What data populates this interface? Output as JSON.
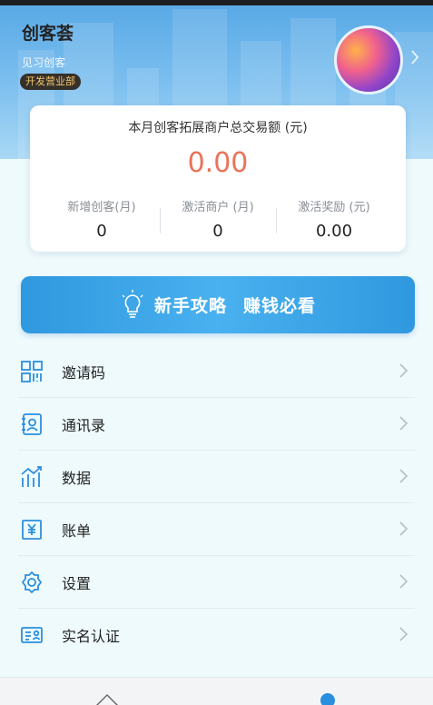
{
  "header": {
    "app_name": "创客荟",
    "role": "见习创客",
    "department": "开发营业部"
  },
  "stats": {
    "title": "本月创客拓展商户总交易额 (元)",
    "amount": "0.00",
    "items": [
      {
        "label": "新增创客(月)",
        "value": "0"
      },
      {
        "label": "激活商户 (月)",
        "value": "0"
      },
      {
        "label": "激活奖励 (元)",
        "value": "0.00"
      }
    ]
  },
  "banner": {
    "text1": "新手攻略",
    "text2": "赚钱必看"
  },
  "menu": [
    {
      "label": "邀请码",
      "icon": "qr-code-icon"
    },
    {
      "label": "通讯录",
      "icon": "contacts-icon"
    },
    {
      "label": "数据",
      "icon": "chart-icon"
    },
    {
      "label": "账单",
      "icon": "bill-icon"
    },
    {
      "label": "设置",
      "icon": "gear-icon"
    },
    {
      "label": "实名认证",
      "icon": "id-card-icon"
    }
  ],
  "colors": {
    "accent": "#2b8fde",
    "amount": "#e8735a",
    "badge_bg": "#35302a",
    "badge_text": "#f4c66d"
  }
}
